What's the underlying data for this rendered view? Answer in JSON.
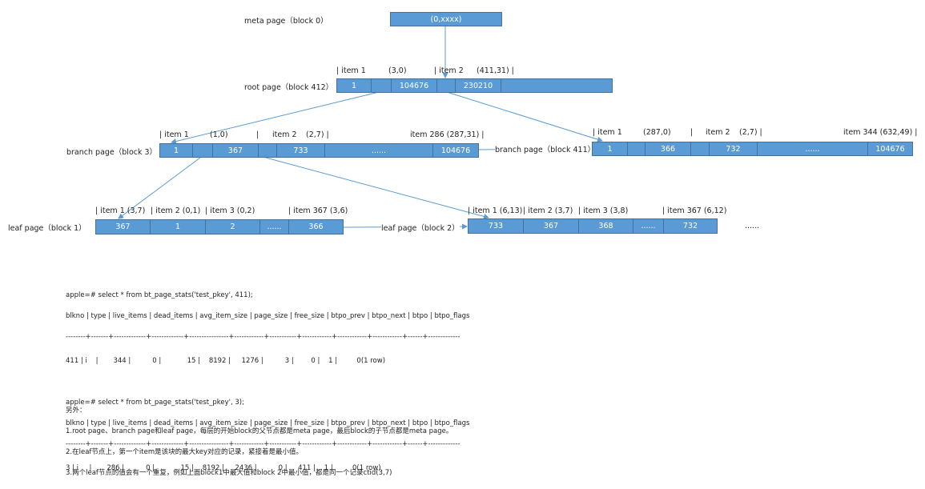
{
  "meta": {
    "label": "meta page（block 0）",
    "cell": "(0,xxxx)"
  },
  "root": {
    "label": "root page（block 412）",
    "headers": [
      "| item 1",
      "(3,0)",
      "|  item 2",
      "(411,31)  |"
    ],
    "cells": [
      "1",
      "",
      "104676",
      "",
      "230210",
      ""
    ]
  },
  "branch3": {
    "label": "branch page（block 3）",
    "headers": [
      "|  item 1",
      "(1,0)",
      "|",
      "item 2",
      "(2,7)  |",
      "item 286 (287,31)  |"
    ],
    "cells": [
      "1",
      "",
      "367",
      "",
      "733",
      "......",
      "104676"
    ]
  },
  "branch411": {
    "label": "branch page（block 411）",
    "headers": [
      "|  item 1",
      "(287,0)",
      "|",
      "item 2",
      "(2,7)  |",
      "item 344 (632,49)  |"
    ],
    "cells": [
      "1",
      "",
      "366",
      "",
      "732",
      "......",
      "104676"
    ]
  },
  "leaf1": {
    "label": "leaf page（block 1）",
    "headers": [
      "| item 1  (3,7)",
      "| item 2 (0,1)",
      "| item 3  (0,2)",
      "| item 367  (3,6)"
    ],
    "cells": [
      "367",
      "1",
      "2",
      "......",
      "366"
    ]
  },
  "leaf2": {
    "label": "leaf page（block 2）",
    "headers": [
      "| item 1  (6,13)",
      "| item 2 (3,7)",
      "| item 3  (3,8)",
      "| item 367 (6,12)"
    ],
    "cells": [
      "733",
      "367",
      "368",
      "......",
      "732"
    ],
    "more": "......"
  },
  "sql": [
    "apple=# select * from bt_page_stats('test_pkey', 411);",
    "blkno | type | live_items | dead_items | avg_item_size | page_size | free_size | btpo_prev | btpo_next | btpo | btpo_flags",
    "--------+-------+-------------+-------------+----------------+------------+-----------+------------+------------+------------+------+-------------",
    "411 | i    |       344 |          0 |            15 |    8192 |     1276 |          3 |        0 |    1 |         0(1 row)",
    "",
    "apple=# select * from bt_page_stats('test_pkey', 3);",
    "blkno | type | live_items | dead_items | avg_item_size | page_size | free_size | btpo_prev | btpo_next | btpo | btpo_flags",
    "--------+-------+-------------+-------------+----------------+------------+-----------+------------+------------+------------+------+-------------",
    "3 | i     |       286 |          0 |            15 |    8192 |     2436 |          0 |     411 |    1 |         0(1 row)"
  ],
  "notes": [
    "另外：",
    "1.root page、branch page和leaf page，每层的开始block的父节点都是meta page，最后block的子节点都是meta page。",
    "2.在leaf节点上，第一个item是该块的最大key对应的记录，紧接着是最小值。",
    "3.两个leaf节点的值会有一个重复，例如上面block1中最大值和block 2中最小值，都是同一个记录ctid(3,7)"
  ],
  "colors": {
    "cell": "#5b9bd5",
    "border": "#41719c",
    "arrow": "#5b9bd5"
  }
}
